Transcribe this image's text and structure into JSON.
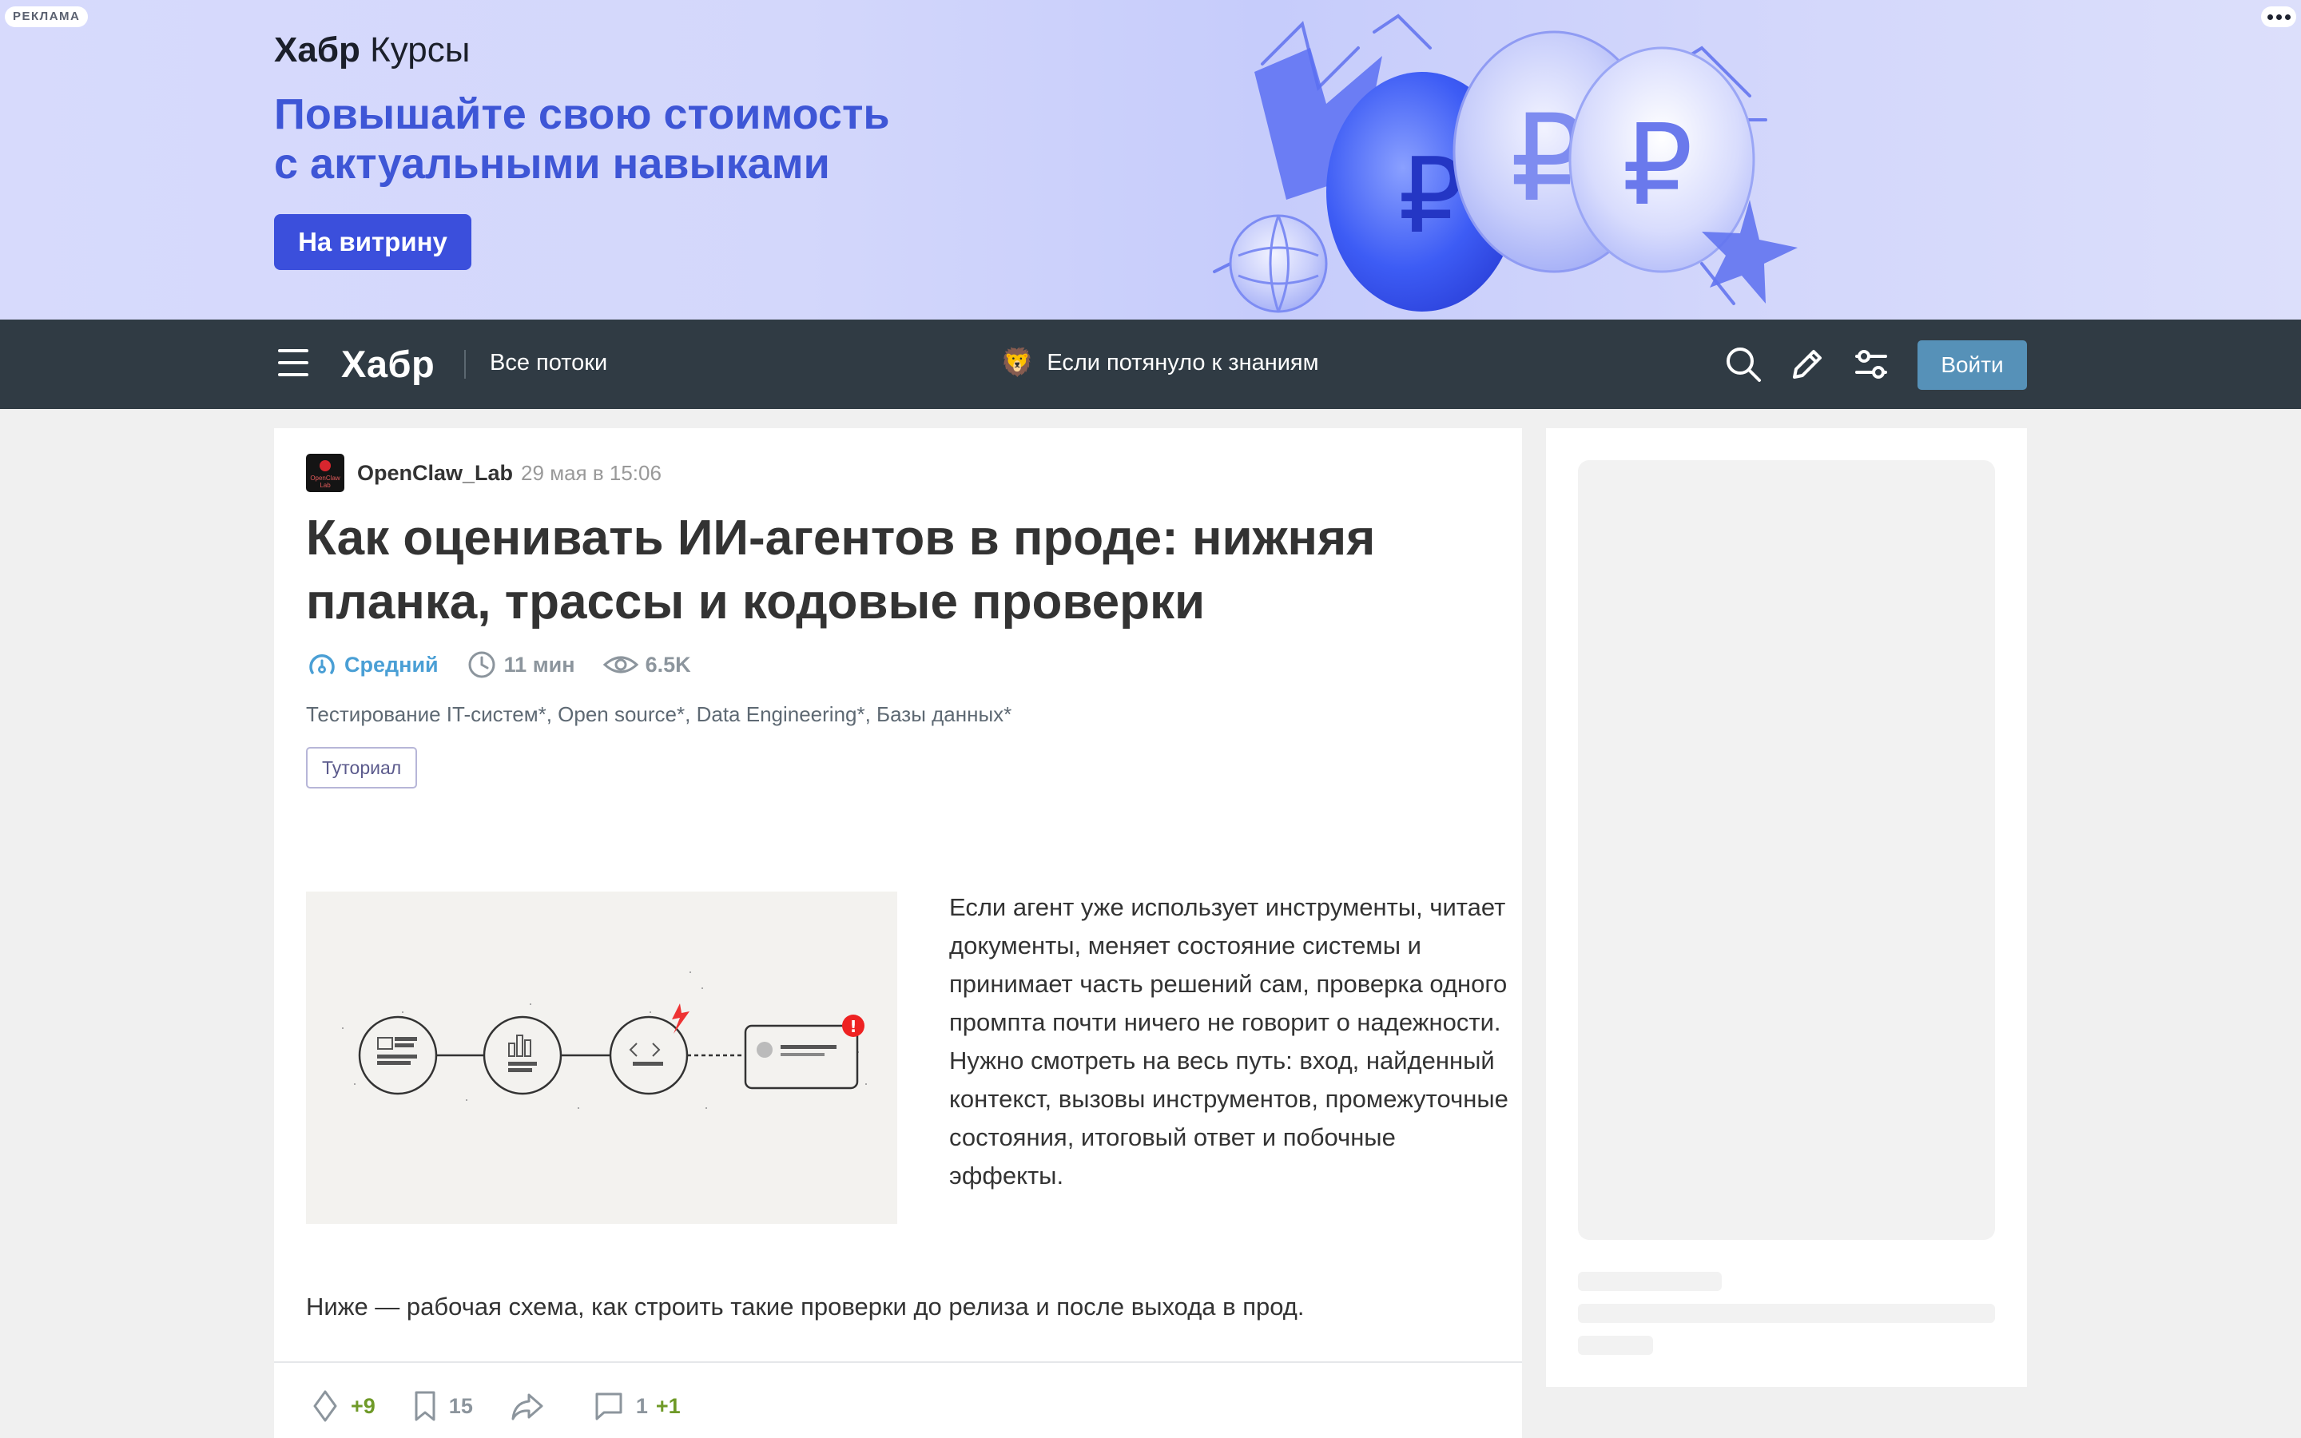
{
  "ad": {
    "tag": "РЕКЛАМА",
    "brand_bold": "Хабр",
    "brand_rest": " Курсы",
    "headline": [
      "Повышайте свою стоимость",
      "с актуальными навыками"
    ],
    "cta": "На витрину",
    "menu_icon": "more-dots-icon"
  },
  "header": {
    "logo": "Хабр",
    "flows": "Все потоки",
    "promo_emoji": "🦁",
    "promo_text": "Если потянуло к знаниям",
    "icons": [
      "search-icon",
      "pencil-icon",
      "settings-sliders-icon"
    ],
    "login": "Войти"
  },
  "article": {
    "author": "OpenClaw_Lab",
    "avatar_text": "OpenClaw Lab",
    "date": "29 мая в 15:06",
    "title": "Как оценивать ИИ-агентов в проде: нижняя планка, трассы и кодовые проверки",
    "level": "Средний",
    "reading_time": "11 мин",
    "views": "6.5K",
    "hubs": "Тестирование IT-систем*, Open source*, Data Engineering*, Базы данных*",
    "tag": "Туториал",
    "lead": "Если агент уже использует инструменты, читает документы, меняет состояние системы и принимает часть решений сам, проверка одного промпта почти ничего не говорит о надежности. Нужно смотреть на весь путь: вход, найденный контекст, вызовы инструментов, промежуточные состояния, итоговый ответ и побочные эффекты.",
    "paragraph": "Ниже — рабочая схема, как строить такие проверки до релиза и после выхода в прод.",
    "actions": {
      "rating": "+9",
      "bookmarks": "15",
      "comments": "1",
      "comments_new": "+1"
    }
  },
  "colors": {
    "header_bg": "#303b44",
    "ad_accent": "#3b4fdc",
    "login_bg": "#5691b8",
    "level_blue": "#4a9fd5",
    "positive_green": "#6f9a28"
  }
}
